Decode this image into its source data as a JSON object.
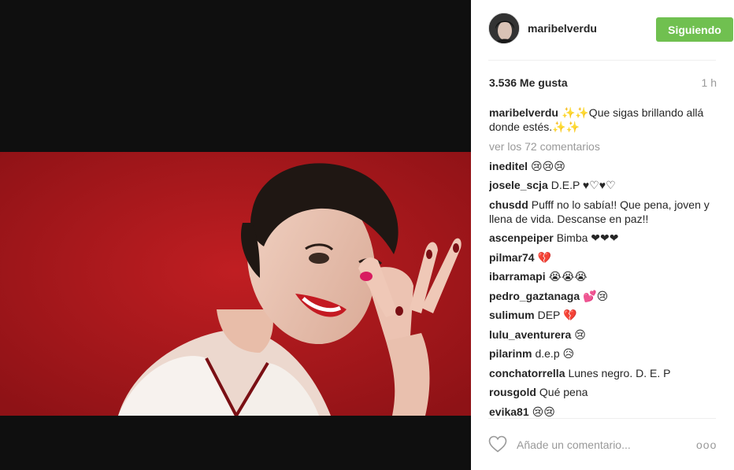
{
  "post": {
    "username": "maribelverdu",
    "follow_label": "Siguiendo",
    "likes": "3.536 Me gusta",
    "time_ago": "1 h",
    "caption": {
      "user": "maribelverdu",
      "text": "✨✨Que sigas brillando allá donde estés.✨✨"
    },
    "view_all": "ver los 72 comentarios",
    "comments": [
      {
        "user": "ineditel",
        "text": "😢😢😢"
      },
      {
        "user": "josele_scja",
        "text": "D.E.P ♥♡♥♡"
      },
      {
        "user": "chusdd",
        "text": "Pufff no lo sabía!! Que pena, joven y llena de vida. Descanse en paz!!"
      },
      {
        "user": "ascenpeiper",
        "text": "Bimba ❤❤❤"
      },
      {
        "user": "pilmar74",
        "text": "💔"
      },
      {
        "user": "ibarramapi",
        "text": "😭😭😭"
      },
      {
        "user": "pedro_gaztanaga",
        "text": "💕😢"
      },
      {
        "user": "sulimum",
        "text": "DEP 💔"
      },
      {
        "user": "lulu_aventurera",
        "text": "😢"
      },
      {
        "user": "pilarinm",
        "text": "d.e.p 😥"
      },
      {
        "user": "conchatorrella",
        "text": "Lunes negro. D. E. P"
      },
      {
        "user": "rousgold",
        "text": "Qué pena"
      },
      {
        "user": "evika81",
        "text": "😢😢"
      }
    ],
    "add_comment_placeholder": "Añade un comentario...",
    "more_label": "ooo"
  },
  "icons": {
    "like": "heart-outline-icon",
    "more": "more-options-icon"
  },
  "colors": {
    "follow_button": "#70c050",
    "photo_background": "#b01a1f",
    "muted_text": "#999999"
  }
}
